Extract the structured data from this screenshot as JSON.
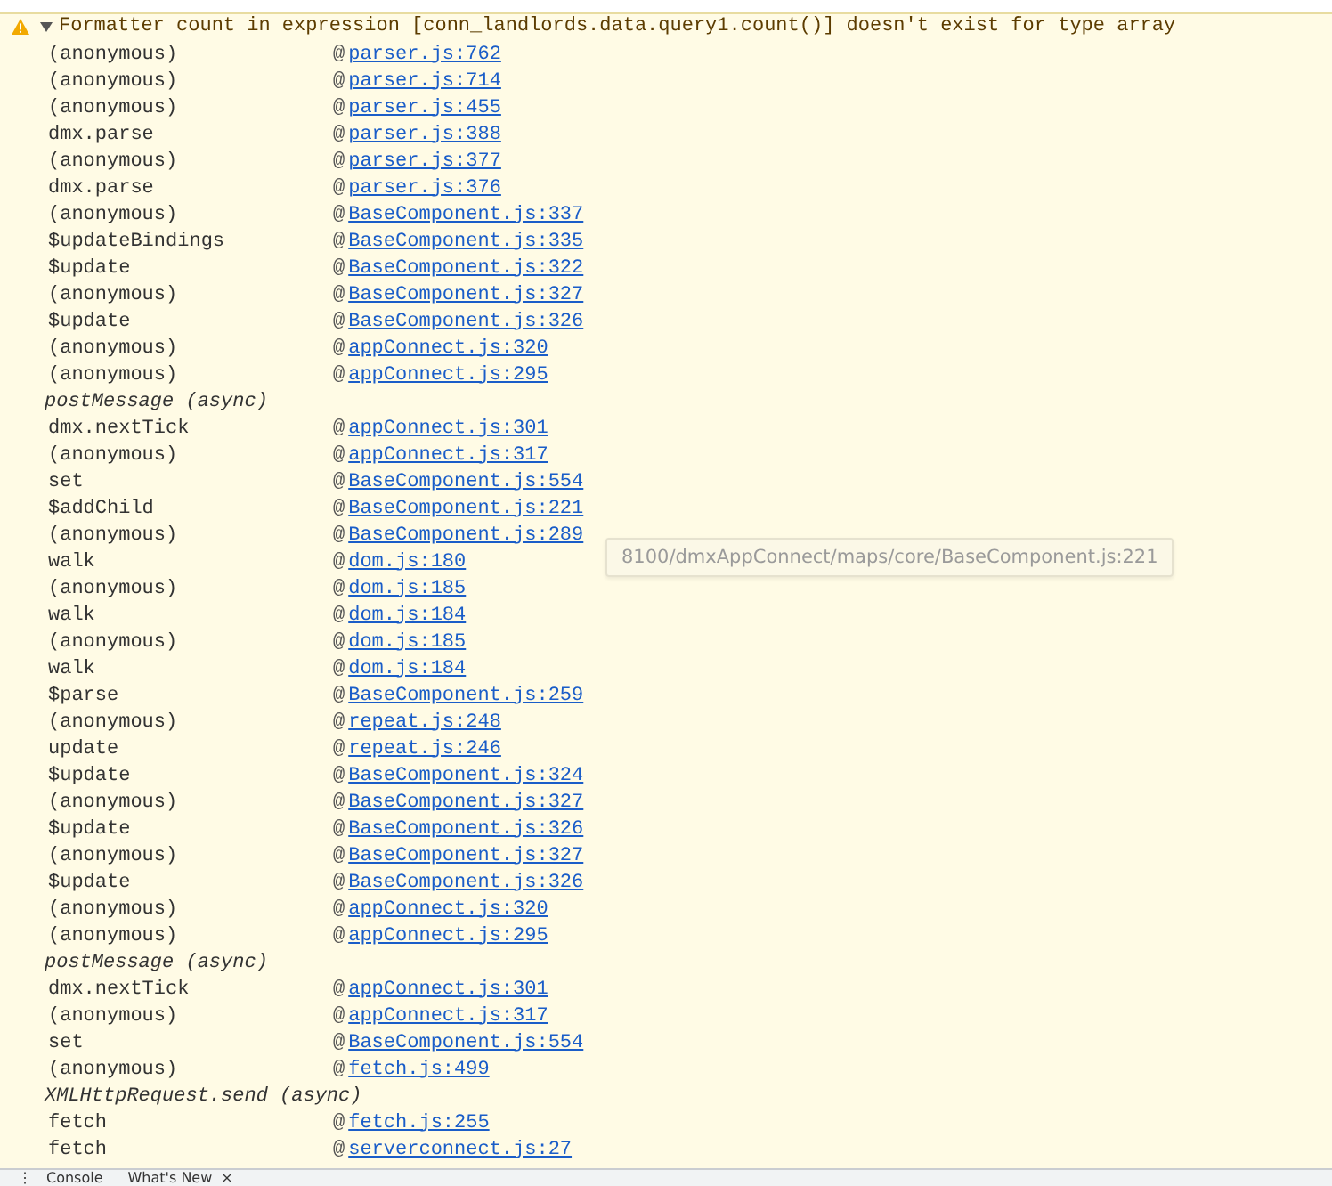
{
  "message": {
    "expanded": true,
    "text": "Formatter count in expression [conn_landlords.data.query1.count()] doesn't exist for type array"
  },
  "stack": [
    {
      "kind": "frame",
      "function": "(anonymous)",
      "location": "parser.js:762"
    },
    {
      "kind": "frame",
      "function": "(anonymous)",
      "location": "parser.js:714"
    },
    {
      "kind": "frame",
      "function": "(anonymous)",
      "location": "parser.js:455"
    },
    {
      "kind": "frame",
      "function": "dmx.parse",
      "location": "parser.js:388"
    },
    {
      "kind": "frame",
      "function": "(anonymous)",
      "location": "parser.js:377"
    },
    {
      "kind": "frame",
      "function": "dmx.parse",
      "location": "parser.js:376"
    },
    {
      "kind": "frame",
      "function": "(anonymous)",
      "location": "BaseComponent.js:337"
    },
    {
      "kind": "frame",
      "function": "$updateBindings",
      "location": "BaseComponent.js:335"
    },
    {
      "kind": "frame",
      "function": "$update",
      "location": "BaseComponent.js:322"
    },
    {
      "kind": "frame",
      "function": "(anonymous)",
      "location": "BaseComponent.js:327"
    },
    {
      "kind": "frame",
      "function": "$update",
      "location": "BaseComponent.js:326"
    },
    {
      "kind": "frame",
      "function": "(anonymous)",
      "location": "appConnect.js:320"
    },
    {
      "kind": "frame",
      "function": "(anonymous)",
      "location": "appConnect.js:295"
    },
    {
      "kind": "async",
      "function": "postMessage (async)"
    },
    {
      "kind": "frame",
      "function": "dmx.nextTick",
      "location": "appConnect.js:301"
    },
    {
      "kind": "frame",
      "function": "(anonymous)",
      "location": "appConnect.js:317"
    },
    {
      "kind": "frame",
      "function": "set",
      "location": "BaseComponent.js:554"
    },
    {
      "kind": "frame",
      "function": "$addChild",
      "location": "BaseComponent.js:221"
    },
    {
      "kind": "frame",
      "function": "(anonymous)",
      "location": "BaseComponent.js:289",
      "tooltip": "8100/dmxAppConnect/maps/core/BaseComponent.js:221"
    },
    {
      "kind": "frame",
      "function": "walk",
      "location": "dom.js:180"
    },
    {
      "kind": "frame",
      "function": "(anonymous)",
      "location": "dom.js:185"
    },
    {
      "kind": "frame",
      "function": "walk",
      "location": "dom.js:184"
    },
    {
      "kind": "frame",
      "function": "(anonymous)",
      "location": "dom.js:185"
    },
    {
      "kind": "frame",
      "function": "walk",
      "location": "dom.js:184"
    },
    {
      "kind": "frame",
      "function": "$parse",
      "location": "BaseComponent.js:259"
    },
    {
      "kind": "frame",
      "function": "(anonymous)",
      "location": "repeat.js:248"
    },
    {
      "kind": "frame",
      "function": "update",
      "location": "repeat.js:246"
    },
    {
      "kind": "frame",
      "function": "$update",
      "location": "BaseComponent.js:324"
    },
    {
      "kind": "frame",
      "function": "(anonymous)",
      "location": "BaseComponent.js:327"
    },
    {
      "kind": "frame",
      "function": "$update",
      "location": "BaseComponent.js:326"
    },
    {
      "kind": "frame",
      "function": "(anonymous)",
      "location": "BaseComponent.js:327"
    },
    {
      "kind": "frame",
      "function": "$update",
      "location": "BaseComponent.js:326"
    },
    {
      "kind": "frame",
      "function": "(anonymous)",
      "location": "appConnect.js:320"
    },
    {
      "kind": "frame",
      "function": "(anonymous)",
      "location": "appConnect.js:295"
    },
    {
      "kind": "async",
      "function": "postMessage (async)"
    },
    {
      "kind": "frame",
      "function": "dmx.nextTick",
      "location": "appConnect.js:301"
    },
    {
      "kind": "frame",
      "function": "(anonymous)",
      "location": "appConnect.js:317"
    },
    {
      "kind": "frame",
      "function": "set",
      "location": "BaseComponent.js:554"
    },
    {
      "kind": "frame",
      "function": "(anonymous)",
      "location": "fetch.js:499"
    },
    {
      "kind": "async",
      "function": "XMLHttpRequest.send (async)"
    },
    {
      "kind": "frame",
      "function": "fetch",
      "location": "fetch.js:255"
    },
    {
      "kind": "frame",
      "function": "fetch",
      "location": "serverconnect.js:27"
    }
  ],
  "at_sign": "@",
  "drawer_tabs": [
    {
      "label": "Console",
      "closable": false
    },
    {
      "label": "What's New",
      "closable": true
    }
  ],
  "drawer_menu": "⋮",
  "close_glyph": "×"
}
